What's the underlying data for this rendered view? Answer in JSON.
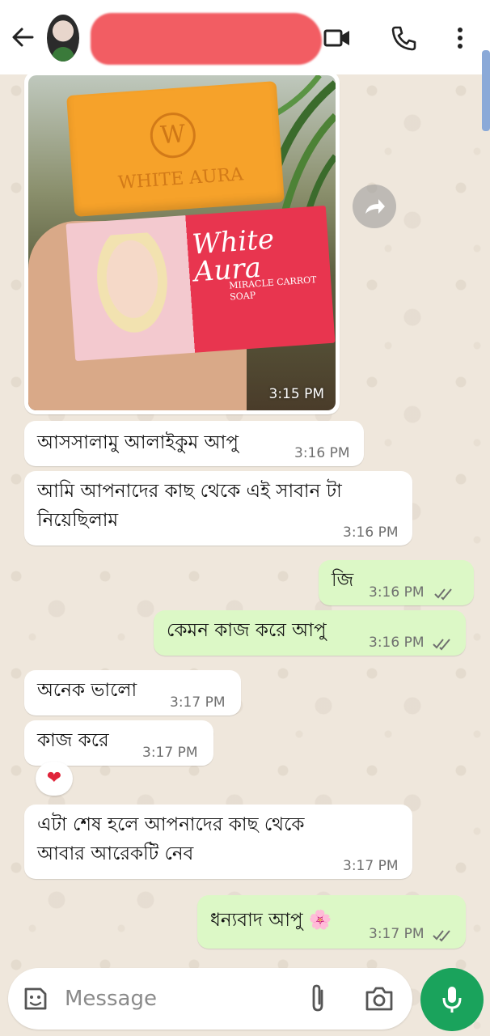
{
  "header": {},
  "messages": [
    {
      "id": "m0",
      "dir": "in",
      "type": "image",
      "time": "3:15 PM",
      "image_text": {
        "brand": "White Aura",
        "embossed": "WHITE AURA",
        "product": "MIRACLE CARROT SOAP"
      }
    },
    {
      "id": "m1",
      "dir": "in",
      "lines": [
        "আসসালামু আলাইকুম আপু"
      ],
      "time": "3:16 PM"
    },
    {
      "id": "m2",
      "dir": "in",
      "lines": [
        "আমি আপনাদের কাছ থেকে এই সাবান টা",
        "নিয়েছিলাম"
      ],
      "time": "3:16 PM"
    },
    {
      "id": "m3",
      "dir": "out",
      "lines": [
        "জি"
      ],
      "time": "3:16 PM",
      "status": "read"
    },
    {
      "id": "m4",
      "dir": "out",
      "lines": [
        "কেমন কাজ করে আপু"
      ],
      "time": "3:16 PM",
      "status": "read"
    },
    {
      "id": "m5",
      "dir": "in",
      "lines": [
        "অনেক ভালো"
      ],
      "time": "3:17 PM"
    },
    {
      "id": "m6",
      "dir": "in",
      "lines": [
        "কাজ করে"
      ],
      "time": "3:17 PM",
      "reaction": "❤"
    },
    {
      "id": "m7",
      "dir": "in",
      "lines": [
        "এটা শেষ হলে আপনাদের কাছ থেকে",
        "আবার আরেকটি নেব"
      ],
      "time": "3:17 PM"
    },
    {
      "id": "m8",
      "dir": "out",
      "lines": [
        "ধন্যবাদ আপু 🌸"
      ],
      "time": "3:17 PM",
      "status": "read"
    }
  ],
  "composer": {
    "placeholder": "Message"
  },
  "colors": {
    "header_bg": "#ffffff",
    "chat_bg": "#efe7dc",
    "incoming": "#ffffff",
    "outgoing": "#dcf8c6",
    "send_button": "#1aa35c",
    "redaction": "#f25d63"
  },
  "icons": {
    "back": "arrow-left-icon",
    "video": "video-camera-icon",
    "call": "phone-icon",
    "menu": "more-vertical-icon",
    "emoji": "sticker-icon",
    "attach": "paperclip-icon",
    "camera": "camera-icon",
    "mic": "microphone-icon",
    "forward": "forward-icon",
    "read": "double-check-icon"
  }
}
